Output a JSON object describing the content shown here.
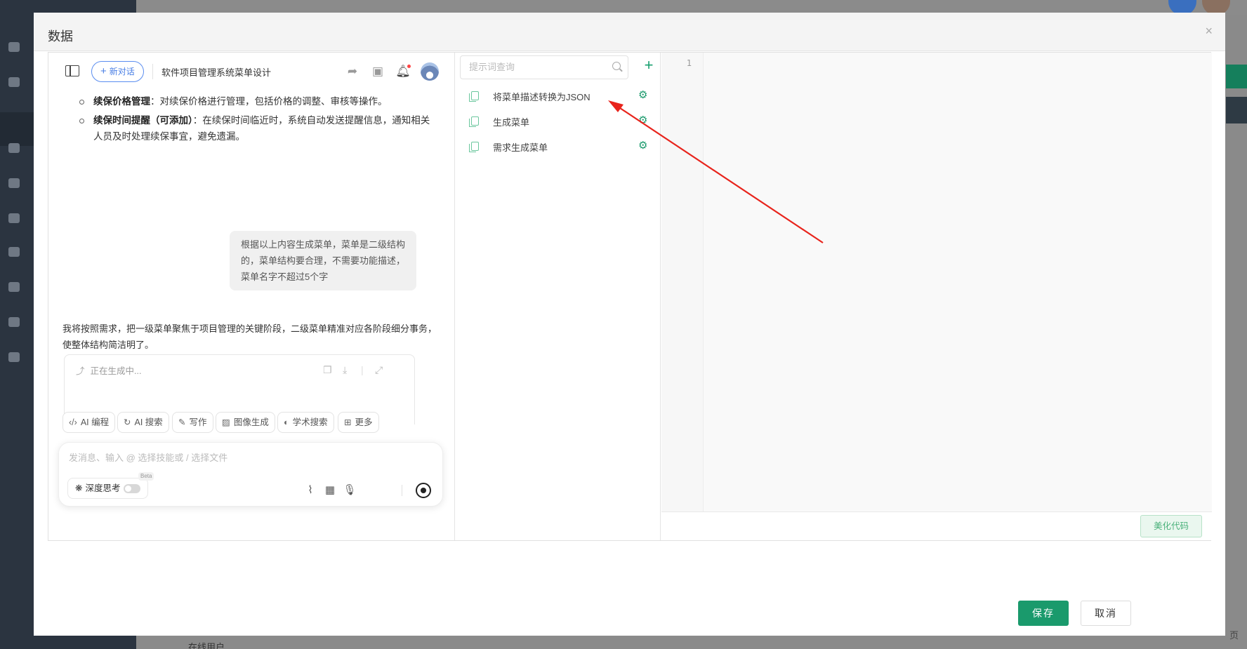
{
  "background": {
    "bottom_label": "在线用户",
    "page_label": "页"
  },
  "dialog": {
    "title": "数据",
    "close": "×",
    "save_label": "保存",
    "cancel_label": "取消"
  },
  "chat": {
    "new_chat_label": "新对话",
    "conversation_title": "软件项目管理系统菜单设计",
    "bullets": [
      {
        "bold": "续保价格管理",
        "text": "：对续保价格进行管理，包括价格的调整、审核等操作。"
      },
      {
        "bold": "续保时间提醒（可添加）",
        "text": "：在续保时间临近时，系统自动发送提醒信息，通知相关人员及时处理续保事宜，避免遗漏。"
      }
    ],
    "user_message": "根据以上内容生成菜单，菜单是二级结构的，菜单结构要合理，不需要功能描述，菜单名字不超过5个字",
    "assistant_message": "我将按照需求，把一级菜单聚焦于项目管理的关键阶段，二级菜单精准对应各阶段细分事务，使整体结构简洁明了。",
    "generating_status": "正在生成中...",
    "tools": [
      "AI 编程",
      "AI 搜索",
      "写作",
      "图像生成",
      "学术搜索",
      "更多"
    ],
    "composer_placeholder": "发消息、输入 @ 选择技能或 / 选择文件",
    "deep_think_label": "深度思考",
    "beta_badge": "Beta"
  },
  "prompts": {
    "search_placeholder": "提示词查询",
    "add_label": "+",
    "items": [
      {
        "label": "将菜单描述转换为JSON"
      },
      {
        "label": "生成菜单"
      },
      {
        "label": "需求生成菜单"
      }
    ]
  },
  "editor": {
    "line_number": "1",
    "beautify_label": "美化代码"
  },
  "colors": {
    "accent_green": "#1a9a6c",
    "link_blue": "#4a7fe5",
    "annotation_red": "#e8241c"
  }
}
